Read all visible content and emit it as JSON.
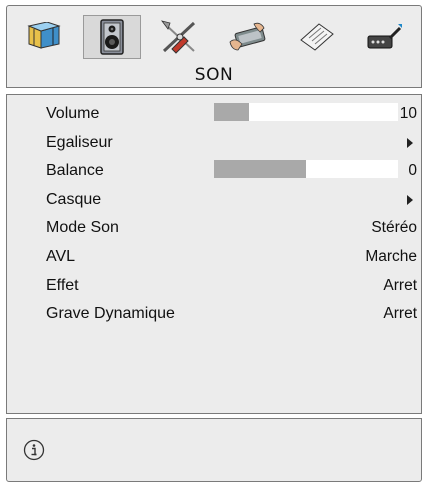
{
  "menu": {
    "title": "SON",
    "tabs": [
      {
        "icon": "picture-icon",
        "selected": false
      },
      {
        "icon": "speaker-icon",
        "selected": true
      },
      {
        "icon": "tools-icon",
        "selected": false
      },
      {
        "icon": "setup-icon",
        "selected": false
      },
      {
        "icon": "document-icon",
        "selected": false
      },
      {
        "icon": "source-icon",
        "selected": false
      }
    ]
  },
  "items": [
    {
      "label": "Volume",
      "value": "10",
      "level": 0.19
    },
    {
      "label": "Egaliseur",
      "value": "",
      "submenu": true
    },
    {
      "label": "Balance",
      "value": "0",
      "level": 0.5
    },
    {
      "label": "Casque",
      "value": "",
      "submenu": true
    },
    {
      "label": "Mode Son",
      "value": "Stéréo"
    },
    {
      "label": "AVL",
      "value": "Marche"
    },
    {
      "label": "Effet",
      "value": "Arret"
    },
    {
      "label": "Grave Dynamique",
      "value": "Arret"
    }
  ],
  "colors": {
    "bar_fill": "#a9a9a9",
    "panel_bg": "#ececec",
    "border": "#7a7a7a"
  },
  "footer": {
    "icon": "info-icon"
  }
}
